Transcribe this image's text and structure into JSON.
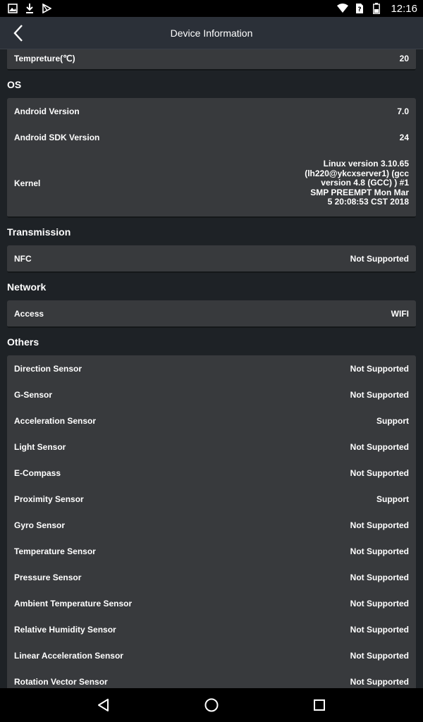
{
  "status_bar": {
    "time": "12:16",
    "left_icons": [
      "image-icon",
      "download-icon",
      "play-store-icon"
    ],
    "right_icons": [
      "wifi-icon",
      "no-sim-icon",
      "battery-icon"
    ]
  },
  "app_bar": {
    "title": "Device Information",
    "back_icon": "back-arrow-icon"
  },
  "top_card": {
    "rows": [
      {
        "label": "Tempreture(℃)",
        "value": "20"
      }
    ]
  },
  "os": {
    "header": "OS",
    "rows": [
      {
        "label": "Android Version",
        "value": "7.0"
      },
      {
        "label": "Android SDK Version",
        "value": "24"
      },
      {
        "label": "Kernel",
        "value": "Linux version 3.10.65\n(lh220@ykcxserver1) (gcc\nversion 4.8 (GCC) ) #1\nSMP PREEMPT Mon Mar\n5 20:08:53 CST 2018"
      }
    ]
  },
  "transmission": {
    "header": "Transmission",
    "rows": [
      {
        "label": "NFC",
        "value": "Not Supported"
      }
    ]
  },
  "network": {
    "header": "Network",
    "rows": [
      {
        "label": "Access",
        "value": "WIFI"
      }
    ]
  },
  "others": {
    "header": "Others",
    "rows": [
      {
        "label": "Direction Sensor",
        "value": "Not Supported"
      },
      {
        "label": "G-Sensor",
        "value": "Not Supported"
      },
      {
        "label": "Acceleration Sensor",
        "value": "Support"
      },
      {
        "label": "Light Sensor",
        "value": "Not Supported"
      },
      {
        "label": "E-Compass",
        "value": "Not Supported"
      },
      {
        "label": "Proximity Sensor",
        "value": "Support"
      },
      {
        "label": "Gyro Sensor",
        "value": "Not Supported"
      },
      {
        "label": "Temperature Sensor",
        "value": "Not Supported"
      },
      {
        "label": "Pressure Sensor",
        "value": "Not Supported"
      },
      {
        "label": "Ambient Temperature Sensor",
        "value": "Not Supported"
      },
      {
        "label": "Relative Humidity Sensor",
        "value": "Not Supported"
      },
      {
        "label": "Linear Acceleration Sensor",
        "value": "Not Supported"
      },
      {
        "label": "Rotation Vector Sensor",
        "value": "Not Supported"
      }
    ]
  },
  "nav_bar": {
    "icons": [
      "back-triangle-icon",
      "home-circle-icon",
      "recents-square-icon"
    ]
  },
  "colors": {
    "background": "#1e2226",
    "card": "#383a3d",
    "app_bar": "#2b3038",
    "text": "#ffffff"
  }
}
